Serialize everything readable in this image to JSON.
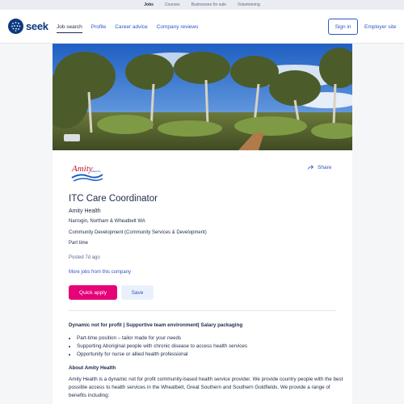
{
  "top_strip": {
    "links": [
      "Jobs",
      "Courses",
      "Businesses for sale",
      "Volunteering"
    ]
  },
  "header": {
    "brand": "seek",
    "nav": [
      "Job search",
      "Profile",
      "Career advice",
      "Company reviews"
    ],
    "sign_in": "Sign in",
    "employer_site": "Employer site"
  },
  "job": {
    "logo_text": "Amity",
    "logo_subtext": "HEALTH",
    "share": "Share",
    "title": "ITC Care Coordinator",
    "company": "Amity Health",
    "location": "Narrogin, Northam & Wheatbelt WA",
    "classification": "Community Development (Community Services & Development)",
    "work_type": "Part time",
    "posted": "Posted 7d ago",
    "more_jobs": "More jobs from this company",
    "apply_label": "Quick apply",
    "save_label": "Save"
  },
  "description": {
    "headline": "Dynamic not for profit | Supportive team environment| Salary packaging",
    "bullets": [
      "Part-time position – tailor made for your needs",
      "Supporting Aboriginal people with chronic disease to access health services",
      "Opportunity for nurse or allied health professional"
    ],
    "about_heading": "About Amity Health",
    "about_text": "Amity Health is a dynamic not for profit community-based health service provider. We provide country people with the best possible access to health services in the Wheatbelt, Great Southern and Southern Goldfields. We provide a range of benefits including:"
  },
  "colors": {
    "brand_navy": "#0d3880",
    "link_blue": "#2e55c4",
    "apply_pink": "#e60278"
  }
}
